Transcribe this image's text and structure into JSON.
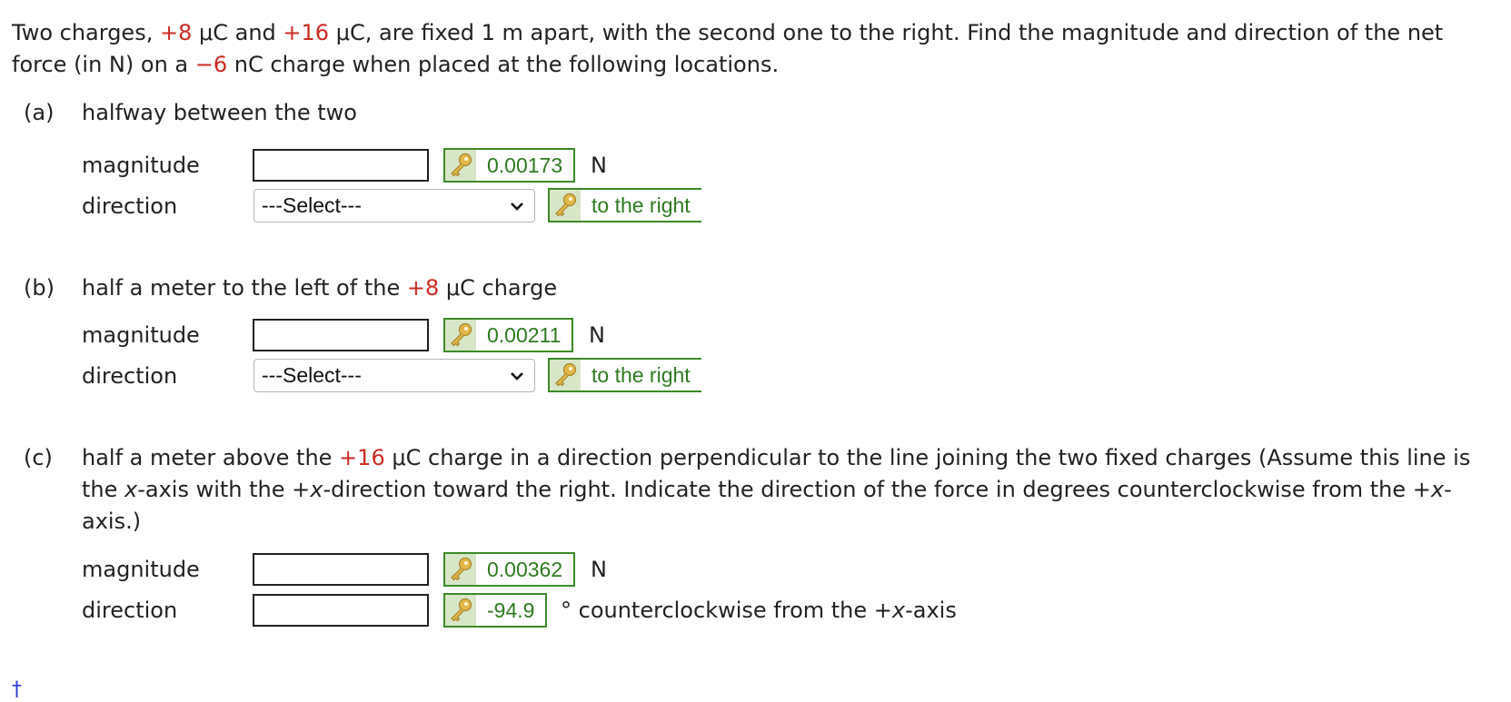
{
  "intro": {
    "t1": "Two charges, ",
    "q1": "+8",
    "t2": " μC and ",
    "q2": "+16",
    "t3": " μC, are fixed 1 m apart, with the second one to the right. Find the magnitude and direction of the net force (in N) on a ",
    "q3": "−6",
    "t4": " nC charge when placed at the following locations."
  },
  "part_a": {
    "label": "(a)",
    "text": "halfway between the two",
    "magnitude_label": "magnitude",
    "magnitude_value": "",
    "magnitude_answer": "0.00173",
    "magnitude_unit": "N",
    "direction_label": "direction",
    "direction_selected": "---Select---",
    "direction_answer": "to the right"
  },
  "part_b": {
    "label": "(b)",
    "text_pre": "half a meter to the left of the ",
    "text_charge": "+8",
    "text_post": " μC charge",
    "magnitude_label": "magnitude",
    "magnitude_value": "",
    "magnitude_answer": "0.00211",
    "magnitude_unit": "N",
    "direction_label": "direction",
    "direction_selected": "---Select---",
    "direction_answer": "to the right"
  },
  "part_c": {
    "label": "(c)",
    "text_pre": "half a meter above the ",
    "text_charge": "+16",
    "text_mid1": " μC charge in a direction perpendicular to the line joining the two fixed charges (Assume this line is the ",
    "x1": "x",
    "text_mid2": "-axis with the +",
    "x2": "x",
    "text_mid3": "-direction toward the right. Indicate the direction of the force in degrees counterclockwise from the +",
    "x3": "x",
    "text_post": "-axis.)",
    "magnitude_label": "magnitude",
    "magnitude_value": "",
    "magnitude_answer": "0.00362",
    "magnitude_unit": "N",
    "direction_label": "direction",
    "direction_value": "",
    "direction_answer": "-94.9",
    "direction_unit_pre": "° counterclockwise from the +",
    "direction_unit_x": "x",
    "direction_unit_post": "-axis"
  },
  "footer": {
    "dagger": "†"
  },
  "colors": {
    "charge_red": "#cc2a22",
    "answer_green": "#2e7a1f",
    "answer_border": "#3b8a26",
    "key_bg": "#d8e6c8",
    "dagger_blue": "#2a3bd6"
  },
  "icons": {
    "answer_key": "key-icon",
    "select_arrow": "chevron-down-icon"
  }
}
